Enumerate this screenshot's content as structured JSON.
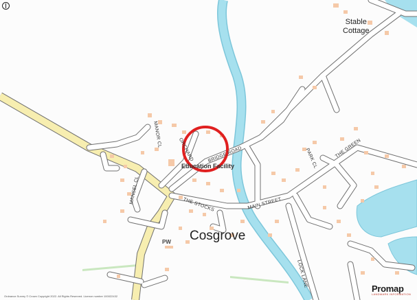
{
  "map": {
    "place_labels": {
      "stable_cottage_line1": "Stable",
      "stable_cottage_line2": "Cottage",
      "education_facility": "Education Facility",
      "cosgrove": "Cosgrove",
      "pw": "PW"
    },
    "road_labels": {
      "orchard": "ORCHARD",
      "bridge_road": "BRIDGE ROAD",
      "manor_cl": "MANOR CL",
      "mansel_cl": "MANSEL CL",
      "the_stocks": "THE STOCKS",
      "main_street": "MAIN STREET",
      "park_cl": "PARK CL",
      "the_green": "THE GREEN",
      "lock_lane": "LOCK LANE"
    },
    "marker": {
      "type": "property-location-circle",
      "color": "#e02020"
    },
    "north_icon": "north-arrow-icon",
    "copyright": "Ordnance Survey © Crown Copyright 2022. All Rights Reserved. Licence number 100022432",
    "brand": {
      "name": "Promap",
      "tagline": "LANDMARK INFORMATION"
    },
    "colors": {
      "water": "#a6e0ee",
      "major_road": "#f7eeb0",
      "minor_road": "#ffffff",
      "road_casing": "#6f6f6f",
      "building": "#f5c9a8",
      "park": "#c9e7bf",
      "marker": "#e02020"
    }
  }
}
